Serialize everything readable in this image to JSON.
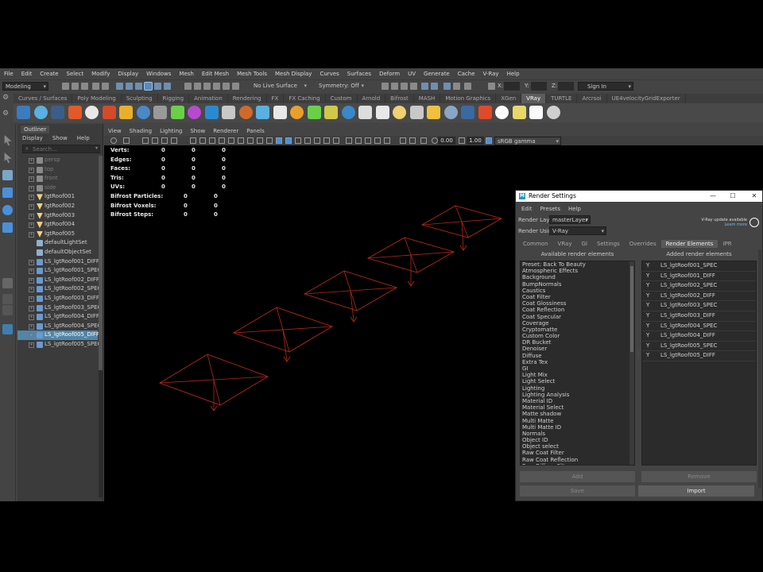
{
  "menubar": [
    "File",
    "Edit",
    "Create",
    "Select",
    "Modify",
    "Display",
    "Windows",
    "Mesh",
    "Edit Mesh",
    "Mesh Tools",
    "Mesh Display",
    "Curves",
    "Surfaces",
    "Deform",
    "UV",
    "Generate",
    "Cache",
    "V-Ray",
    "Help"
  ],
  "statusline": {
    "mode": "Modeling",
    "live_surface": "No Live Surface",
    "symmetry": "Symmetry: Off",
    "x_label": "X:",
    "y_label": "Y:",
    "z_label": "Z:",
    "sign_in": "Sign In"
  },
  "shelf_tabs": [
    "Curves / Surfaces",
    "Poly Modeling",
    "Sculpting",
    "Rigging",
    "Animation",
    "Rendering",
    "FX",
    "FX Caching",
    "Custom",
    "Arnold",
    "Bifrost",
    "MASH",
    "Motion Graphics",
    "XGen",
    "VRay",
    "TURTLE",
    "Arcrsoi",
    "UE4velocityGridExporter"
  ],
  "shelf_active": "VRay",
  "outliner": {
    "title": "Outliner",
    "menu": [
      "Display",
      "Show",
      "Help"
    ],
    "search_placeholder": "Search...",
    "items": [
      {
        "label": "persp",
        "icon": "camera-icon",
        "dim": true
      },
      {
        "label": "top",
        "icon": "camera-icon",
        "dim": true
      },
      {
        "label": "front",
        "icon": "camera-icon",
        "dim": true
      },
      {
        "label": "side",
        "icon": "camera-icon",
        "dim": true
      },
      {
        "label": "lgtRoof001",
        "icon": "rect-light-icon"
      },
      {
        "label": "lgtRoof002",
        "icon": "rect-light-icon"
      },
      {
        "label": "lgtRoof003",
        "icon": "rect-light-icon"
      },
      {
        "label": "lgtRoof004",
        "icon": "rect-light-icon"
      },
      {
        "label": "lgtRoof005",
        "icon": "rect-light-icon"
      },
      {
        "label": "defaultLightSet",
        "icon": "set-icon"
      },
      {
        "label": "defaultObjectSet",
        "icon": "set-icon"
      },
      {
        "label": "LS_lgtRoof001_DIFF",
        "icon": "render-element-icon"
      },
      {
        "label": "LS_lgtRoof001_SPEC",
        "icon": "render-element-icon"
      },
      {
        "label": "LS_lgtRoof002_DIFF",
        "icon": "render-element-icon"
      },
      {
        "label": "LS_lgtRoof002_SPEC",
        "icon": "render-element-icon"
      },
      {
        "label": "LS_lgtRoof003_DIFF",
        "icon": "render-element-icon"
      },
      {
        "label": "LS_lgtRoof003_SPEC",
        "icon": "render-element-icon"
      },
      {
        "label": "LS_lgtRoof004_DIFF",
        "icon": "render-element-icon"
      },
      {
        "label": "LS_lgtRoof004_SPEC",
        "icon": "render-element-icon"
      },
      {
        "label": "LS_lgtRoof005_DIFF",
        "icon": "render-element-icon",
        "selected": true
      },
      {
        "label": "LS_lgtRoof005_SPEC",
        "icon": "render-element-icon"
      }
    ]
  },
  "viewport": {
    "menu": [
      "View",
      "Shading",
      "Lighting",
      "Show",
      "Renderer",
      "Panels"
    ],
    "near_clip": "0.00",
    "far_clip": "1.00",
    "color_space": "sRGB gamma",
    "hud": [
      {
        "label": "Verts:",
        "a": "0",
        "b": "0",
        "c": "0"
      },
      {
        "label": "Edges:",
        "a": "0",
        "b": "0",
        "c": "0"
      },
      {
        "label": "Faces:",
        "a": "0",
        "b": "0",
        "c": "0"
      },
      {
        "label": "Tris:",
        "a": "0",
        "b": "0",
        "c": "0"
      },
      {
        "label": "UVs:",
        "a": "0",
        "b": "0",
        "c": "0"
      },
      {
        "label": "Bifrost Particles:",
        "a": "0",
        "b": "0"
      },
      {
        "label": "Bifrost Voxels:",
        "a": "0",
        "b": "0"
      },
      {
        "label": "Bifrost Steps:",
        "a": "0",
        "b": "0"
      }
    ],
    "wire_color": "#b52a1a"
  },
  "render_settings": {
    "title": "Render Settings",
    "menu": [
      "Edit",
      "Presets",
      "Help"
    ],
    "render_layer_label": "Render Layer",
    "render_layer_value": "masterLayer",
    "render_using_label": "Render Using",
    "render_using_value": "V-Ray",
    "vray_update_line1": "V-Ray update available",
    "vray_update_line2": "Learn more",
    "tabs": [
      "Common",
      "VRay",
      "GI",
      "Settings",
      "Overrides",
      "Render Elements",
      "IPR"
    ],
    "active_tab": "Render Elements",
    "available_header": "Available render elements",
    "added_header": "Added render elements",
    "available": [
      "Preset: Back To Beauty",
      "Atmospheric Effects",
      "Background",
      "BumpNormals",
      "Caustics",
      "Coat Filter",
      "Coat Glossiness",
      "Coat Reflection",
      "Coat Specular",
      "Coverage",
      "Cryptomatte",
      "Custom Color",
      "DR Bucket",
      "Denoiser",
      "Diffuse",
      "Extra Tex",
      "GI",
      "Light Mix",
      "Light Select",
      "Lighting",
      "Lighting Analysis",
      "Material ID",
      "Material Select",
      "Matte shadow",
      "Multi Matte",
      "Multi Matte ID",
      "Normals",
      "Object ID",
      "Object select",
      "Raw Coat Filter",
      "Raw Coat Reflection",
      "Raw Diffuse Filter"
    ],
    "added": [
      {
        "enabled": "Y",
        "name": "LS_lgtRoof001_SPEC"
      },
      {
        "enabled": "Y",
        "name": "LS_lgtRoof001_DIFF"
      },
      {
        "enabled": "Y",
        "name": "LS_lgtRoof002_SPEC"
      },
      {
        "enabled": "Y",
        "name": "LS_lgtRoof002_DIFF"
      },
      {
        "enabled": "Y",
        "name": "LS_lgtRoof003_SPEC"
      },
      {
        "enabled": "Y",
        "name": "LS_lgtRoof003_DIFF"
      },
      {
        "enabled": "Y",
        "name": "LS_lgtRoof004_SPEC"
      },
      {
        "enabled": "Y",
        "name": "LS_lgtRoof004_DIFF"
      },
      {
        "enabled": "Y",
        "name": "LS_lgtRoof005_SPEC"
      },
      {
        "enabled": "Y",
        "name": "LS_lgtRoof005_DIFF"
      }
    ],
    "buttons": {
      "add": "Add",
      "remove": "Remove",
      "save": "Save",
      "import": "Import"
    }
  }
}
